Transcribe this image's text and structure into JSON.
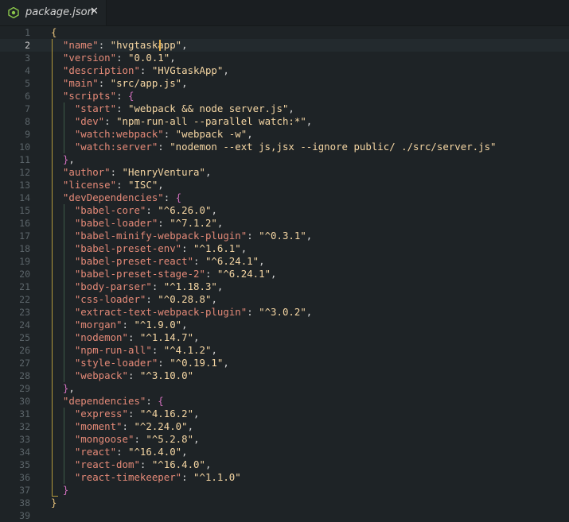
{
  "tab": {
    "filename": "package.json",
    "close": "✕",
    "icon": "json-file-icon"
  },
  "cursor_line": 2,
  "colors": {
    "key": "#e58a78",
    "string": "#f5d6a3",
    "brace_outer": "#e5c07b",
    "brace_inner": "#d16fbd",
    "background": "#1e2326"
  },
  "lines": [
    {
      "n": "1",
      "t": [
        [
          "{",
          "b1"
        ]
      ]
    },
    {
      "n": "2",
      "t": [
        [
          "  ",
          ""
        ],
        [
          "\"name\"",
          "k"
        ],
        [
          ": ",
          "p"
        ],
        [
          "\"hvgtaskapp\"",
          "s"
        ],
        [
          ",",
          "p"
        ]
      ]
    },
    {
      "n": "3",
      "t": [
        [
          "  ",
          ""
        ],
        [
          "\"version\"",
          "k"
        ],
        [
          ": ",
          "p"
        ],
        [
          "\"0.0.1\"",
          "s"
        ],
        [
          ",",
          "p"
        ]
      ]
    },
    {
      "n": "4",
      "t": [
        [
          "  ",
          ""
        ],
        [
          "\"description\"",
          "k"
        ],
        [
          ": ",
          "p"
        ],
        [
          "\"HVGtaskApp\"",
          "s"
        ],
        [
          ",",
          "p"
        ]
      ]
    },
    {
      "n": "5",
      "t": [
        [
          "  ",
          ""
        ],
        [
          "\"main\"",
          "k"
        ],
        [
          ": ",
          "p"
        ],
        [
          "\"src/app.js\"",
          "s"
        ],
        [
          ",",
          "p"
        ]
      ]
    },
    {
      "n": "6",
      "t": [
        [
          "  ",
          ""
        ],
        [
          "\"scripts\"",
          "k"
        ],
        [
          ": ",
          "p"
        ],
        [
          "{",
          "b2"
        ]
      ]
    },
    {
      "n": "7",
      "t": [
        [
          "    ",
          ""
        ],
        [
          "\"start\"",
          "k"
        ],
        [
          ": ",
          "p"
        ],
        [
          "\"webpack && node server.js\"",
          "s"
        ],
        [
          ",",
          "p"
        ]
      ]
    },
    {
      "n": "8",
      "t": [
        [
          "    ",
          ""
        ],
        [
          "\"dev\"",
          "k"
        ],
        [
          ": ",
          "p"
        ],
        [
          "\"npm-run-all --parallel watch:*\"",
          "s"
        ],
        [
          ",",
          "p"
        ]
      ]
    },
    {
      "n": "9",
      "t": [
        [
          "    ",
          ""
        ],
        [
          "\"watch:webpack\"",
          "k"
        ],
        [
          ": ",
          "p"
        ],
        [
          "\"webpack -w\"",
          "s"
        ],
        [
          ",",
          "p"
        ]
      ]
    },
    {
      "n": "10",
      "t": [
        [
          "    ",
          ""
        ],
        [
          "\"watch:server\"",
          "k"
        ],
        [
          ": ",
          "p"
        ],
        [
          "\"nodemon --ext js,jsx --ignore public/ ./src/server.js\"",
          "s"
        ]
      ]
    },
    {
      "n": "11",
      "t": [
        [
          "  ",
          ""
        ],
        [
          "}",
          "b2"
        ],
        [
          ",",
          "p"
        ]
      ]
    },
    {
      "n": "12",
      "t": [
        [
          "  ",
          ""
        ],
        [
          "\"author\"",
          "k"
        ],
        [
          ": ",
          "p"
        ],
        [
          "\"HenryVentura\"",
          "s"
        ],
        [
          ",",
          "p"
        ]
      ]
    },
    {
      "n": "13",
      "t": [
        [
          "  ",
          ""
        ],
        [
          "\"license\"",
          "k"
        ],
        [
          ": ",
          "p"
        ],
        [
          "\"ISC\"",
          "s"
        ],
        [
          ",",
          "p"
        ]
      ]
    },
    {
      "n": "14",
      "t": [
        [
          "  ",
          ""
        ],
        [
          "\"devDependencies\"",
          "k"
        ],
        [
          ": ",
          "p"
        ],
        [
          "{",
          "b2"
        ]
      ]
    },
    {
      "n": "15",
      "t": [
        [
          "    ",
          ""
        ],
        [
          "\"babel-core\"",
          "k"
        ],
        [
          ": ",
          "p"
        ],
        [
          "\"^6.26.0\"",
          "s"
        ],
        [
          ",",
          "p"
        ]
      ]
    },
    {
      "n": "16",
      "t": [
        [
          "    ",
          ""
        ],
        [
          "\"babel-loader\"",
          "k"
        ],
        [
          ": ",
          "p"
        ],
        [
          "\"^7.1.2\"",
          "s"
        ],
        [
          ",",
          "p"
        ]
      ]
    },
    {
      "n": "17",
      "t": [
        [
          "    ",
          ""
        ],
        [
          "\"babel-minify-webpack-plugin\"",
          "k"
        ],
        [
          ": ",
          "p"
        ],
        [
          "\"^0.3.1\"",
          "s"
        ],
        [
          ",",
          "p"
        ]
      ]
    },
    {
      "n": "18",
      "t": [
        [
          "    ",
          ""
        ],
        [
          "\"babel-preset-env\"",
          "k"
        ],
        [
          ": ",
          "p"
        ],
        [
          "\"^1.6.1\"",
          "s"
        ],
        [
          ",",
          "p"
        ]
      ]
    },
    {
      "n": "19",
      "t": [
        [
          "    ",
          ""
        ],
        [
          "\"babel-preset-react\"",
          "k"
        ],
        [
          ": ",
          "p"
        ],
        [
          "\"^6.24.1\"",
          "s"
        ],
        [
          ",",
          "p"
        ]
      ]
    },
    {
      "n": "20",
      "t": [
        [
          "    ",
          ""
        ],
        [
          "\"babel-preset-stage-2\"",
          "k"
        ],
        [
          ": ",
          "p"
        ],
        [
          "\"^6.24.1\"",
          "s"
        ],
        [
          ",",
          "p"
        ]
      ]
    },
    {
      "n": "21",
      "t": [
        [
          "    ",
          ""
        ],
        [
          "\"body-parser\"",
          "k"
        ],
        [
          ": ",
          "p"
        ],
        [
          "\"^1.18.3\"",
          "s"
        ],
        [
          ",",
          "p"
        ]
      ]
    },
    {
      "n": "22",
      "t": [
        [
          "    ",
          ""
        ],
        [
          "\"css-loader\"",
          "k"
        ],
        [
          ": ",
          "p"
        ],
        [
          "\"^0.28.8\"",
          "s"
        ],
        [
          ",",
          "p"
        ]
      ]
    },
    {
      "n": "23",
      "t": [
        [
          "    ",
          ""
        ],
        [
          "\"extract-text-webpack-plugin\"",
          "k"
        ],
        [
          ": ",
          "p"
        ],
        [
          "\"^3.0.2\"",
          "s"
        ],
        [
          ",",
          "p"
        ]
      ]
    },
    {
      "n": "24",
      "t": [
        [
          "    ",
          ""
        ],
        [
          "\"morgan\"",
          "k"
        ],
        [
          ": ",
          "p"
        ],
        [
          "\"^1.9.0\"",
          "s"
        ],
        [
          ",",
          "p"
        ]
      ]
    },
    {
      "n": "25",
      "t": [
        [
          "    ",
          ""
        ],
        [
          "\"nodemon\"",
          "k"
        ],
        [
          ": ",
          "p"
        ],
        [
          "\"^1.14.7\"",
          "s"
        ],
        [
          ",",
          "p"
        ]
      ]
    },
    {
      "n": "26",
      "t": [
        [
          "    ",
          ""
        ],
        [
          "\"npm-run-all\"",
          "k"
        ],
        [
          ": ",
          "p"
        ],
        [
          "\"^4.1.2\"",
          "s"
        ],
        [
          ",",
          "p"
        ]
      ]
    },
    {
      "n": "27",
      "t": [
        [
          "    ",
          ""
        ],
        [
          "\"style-loader\"",
          "k"
        ],
        [
          ": ",
          "p"
        ],
        [
          "\"^0.19.1\"",
          "s"
        ],
        [
          ",",
          "p"
        ]
      ]
    },
    {
      "n": "28",
      "t": [
        [
          "    ",
          ""
        ],
        [
          "\"webpack\"",
          "k"
        ],
        [
          ": ",
          "p"
        ],
        [
          "\"^3.10.0\"",
          "s"
        ]
      ]
    },
    {
      "n": "29",
      "t": [
        [
          "  ",
          ""
        ],
        [
          "}",
          "b2"
        ],
        [
          ",",
          "p"
        ]
      ]
    },
    {
      "n": "30",
      "t": [
        [
          "  ",
          ""
        ],
        [
          "\"dependencies\"",
          "k"
        ],
        [
          ": ",
          "p"
        ],
        [
          "{",
          "b2"
        ]
      ]
    },
    {
      "n": "31",
      "t": [
        [
          "    ",
          ""
        ],
        [
          "\"express\"",
          "k"
        ],
        [
          ": ",
          "p"
        ],
        [
          "\"^4.16.2\"",
          "s"
        ],
        [
          ",",
          "p"
        ]
      ]
    },
    {
      "n": "32",
      "t": [
        [
          "    ",
          ""
        ],
        [
          "\"moment\"",
          "k"
        ],
        [
          ": ",
          "p"
        ],
        [
          "\"^2.24.0\"",
          "s"
        ],
        [
          ",",
          "p"
        ]
      ]
    },
    {
      "n": "33",
      "t": [
        [
          "    ",
          ""
        ],
        [
          "\"mongoose\"",
          "k"
        ],
        [
          ": ",
          "p"
        ],
        [
          "\"^5.2.8\"",
          "s"
        ],
        [
          ",",
          "p"
        ]
      ]
    },
    {
      "n": "34",
      "t": [
        [
          "    ",
          ""
        ],
        [
          "\"react\"",
          "k"
        ],
        [
          ": ",
          "p"
        ],
        [
          "\"^16.4.0\"",
          "s"
        ],
        [
          ",",
          "p"
        ]
      ]
    },
    {
      "n": "35",
      "t": [
        [
          "    ",
          ""
        ],
        [
          "\"react-dom\"",
          "k"
        ],
        [
          ": ",
          "p"
        ],
        [
          "\"^16.4.0\"",
          "s"
        ],
        [
          ",",
          "p"
        ]
      ]
    },
    {
      "n": "36",
      "t": [
        [
          "    ",
          ""
        ],
        [
          "\"react-timekeeper\"",
          "k"
        ],
        [
          ": ",
          "p"
        ],
        [
          "\"^1.1.0\"",
          "s"
        ]
      ]
    },
    {
      "n": "37",
      "t": [
        [
          "  ",
          ""
        ],
        [
          "}",
          "b2"
        ]
      ]
    },
    {
      "n": "38",
      "t": [
        [
          "}",
          "b1"
        ]
      ]
    },
    {
      "n": "39",
      "t": []
    }
  ]
}
